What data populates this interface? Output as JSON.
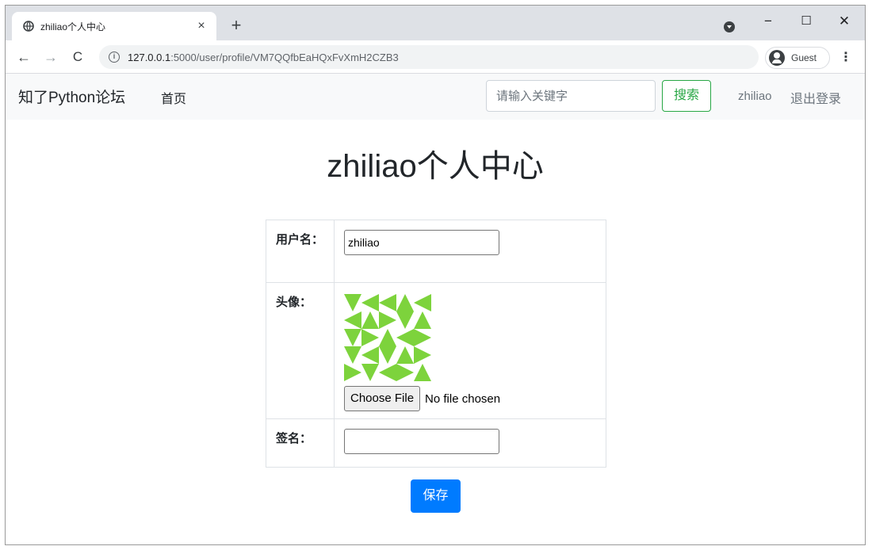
{
  "browser": {
    "tab_title": "zhiliao个人中心",
    "tab_close": "×",
    "new_tab": "+",
    "window_min": "−",
    "window_max": "☐",
    "window_close": "✕",
    "back": "←",
    "forward": "→",
    "reload": "C",
    "info": "i",
    "url_host": "127.0.0.1",
    "url_path": ":5000/user/profile/VM7QQfbEaHQxFvXmH2CZB3",
    "profile_label": "Guest",
    "menu": "⋮"
  },
  "navbar": {
    "brand": "知了Python论坛",
    "home": "首页",
    "search_placeholder": "请输入关键字",
    "search_button": "搜索",
    "username": "zhiliao",
    "logout": "退出登录"
  },
  "main": {
    "title": "zhiliao个人中心",
    "username_label": "用户名：",
    "username_value": "zhiliao",
    "avatar_label": "头像：",
    "file_button": "Choose File",
    "file_status": "No file chosen",
    "signature_label": "签名：",
    "signature_value": "",
    "save_button": "保存"
  },
  "colors": {
    "avatar_color": "#7dd33c",
    "accent_blue": "#007bff",
    "accent_green": "#28a745"
  },
  "icons": [
    "globe-icon",
    "tab-search-icon",
    "info-icon",
    "profile-icon"
  ]
}
